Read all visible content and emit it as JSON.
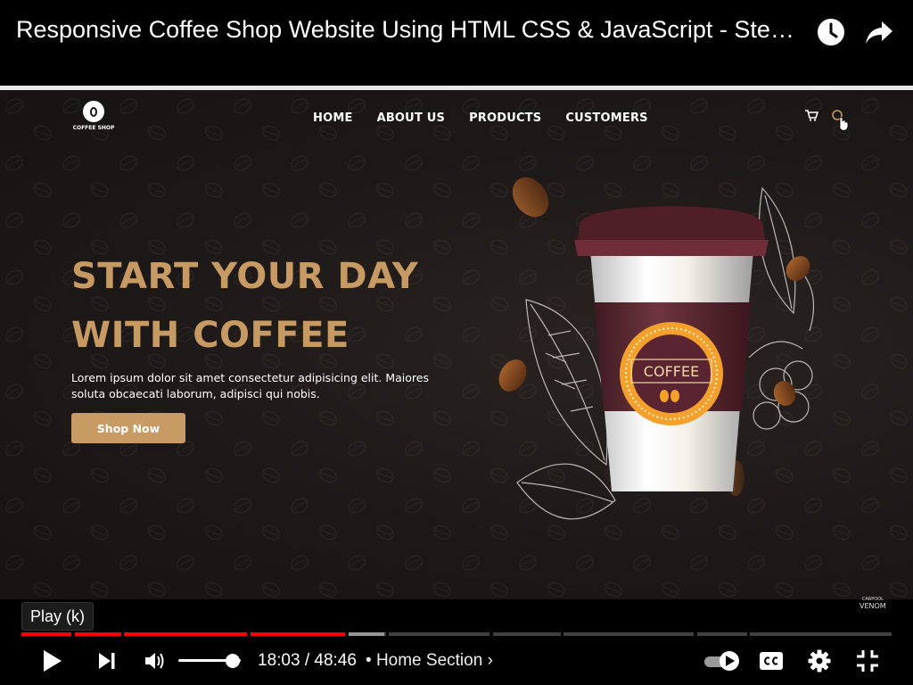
{
  "header": {
    "title": "Responsive Coffee Shop Website Using HTML CSS & JavaScript - Step by Step Tutorial",
    "watch_later_icon": "clock-icon",
    "share_icon": "share-arrow-icon"
  },
  "video_frame": {
    "site": {
      "logo_text": "COFFEE SHOP",
      "nav": [
        "HOME",
        "ABOUT US",
        "PRODUCTS",
        "CUSTOMERS"
      ],
      "icons": [
        "cart-icon",
        "search-icon"
      ],
      "hero_line1": "START YOUR DAY",
      "hero_line2": "WITH COFFEE",
      "hero_paragraph": "Lorem ipsum dolor sit amet consectetur adipisicing elit. Maiores soluta obcaecati laborum, adipisci qui nobis.",
      "cta_label": "Shop Now",
      "cup_label": "COFFEE",
      "accent_color": "#c69a62",
      "cup_color": "#5e2a33"
    },
    "watermark_top": "CARPOOL",
    "watermark": "VENOM"
  },
  "tooltip": "Play (k)",
  "player": {
    "progress_fraction": 0.3759,
    "current_time": "18:03",
    "duration": "48:46",
    "time_separator": "/",
    "chapter_bullet": "•",
    "chapter": "Home Section",
    "chapter_chevron": "›",
    "volume_fraction": 0.85,
    "autoplay": true,
    "played_color": "#ff0000",
    "icons": [
      "play-icon",
      "next-icon",
      "volume-icon",
      "autoplay-toggle-icon",
      "captions-icon",
      "settings-gear-icon",
      "exit-fullscreen-icon"
    ]
  }
}
